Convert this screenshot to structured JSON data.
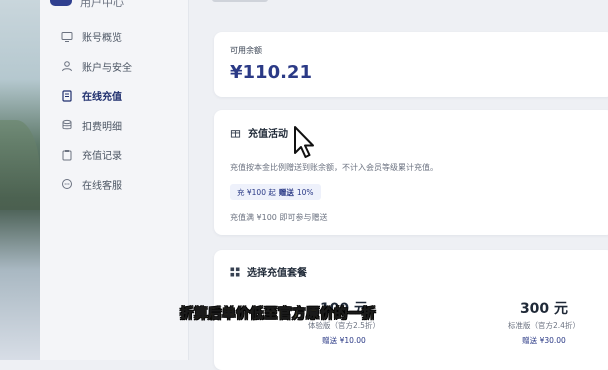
{
  "brand": {
    "label": "用户中心"
  },
  "sidebar": {
    "items": [
      {
        "label": "账号概览",
        "icon": "monitor-icon",
        "active": false
      },
      {
        "label": "账户与安全",
        "icon": "user-icon",
        "active": false
      },
      {
        "label": "在线充值",
        "icon": "document-icon",
        "active": true
      },
      {
        "label": "扣费明细",
        "icon": "database-icon",
        "active": false
      },
      {
        "label": "充值记录",
        "icon": "clipboard-icon",
        "active": false
      },
      {
        "label": "在线客服",
        "icon": "chat-icon",
        "active": false
      }
    ]
  },
  "balance": {
    "label": "可用余额",
    "amount": "¥110.21"
  },
  "promo": {
    "title": "充值活动",
    "desc": "充值按本金比例赠送到账余额，不计入会员等级累计充值。",
    "badge_prefix": "充 ¥100 起",
    "badge_strong": "赠送",
    "badge_suffix": "10%",
    "note": "充值满 ¥100 即可参与赠送"
  },
  "packages": {
    "title": "选择充值套餐",
    "items": [
      {
        "price": "100 元",
        "sub": "体验版（官方2.5折）",
        "gift_label": "赠送",
        "gift_value": "¥10.00"
      },
      {
        "price": "300 元",
        "sub": "标准版（官方2.4折）",
        "gift_label": "赠送",
        "gift_value": "¥30.00"
      }
    ]
  },
  "subtitle": "折算后单价低至官方原价的一折",
  "colors": {
    "accent": "#2b3a86",
    "subtitle": "#ffe51a"
  }
}
